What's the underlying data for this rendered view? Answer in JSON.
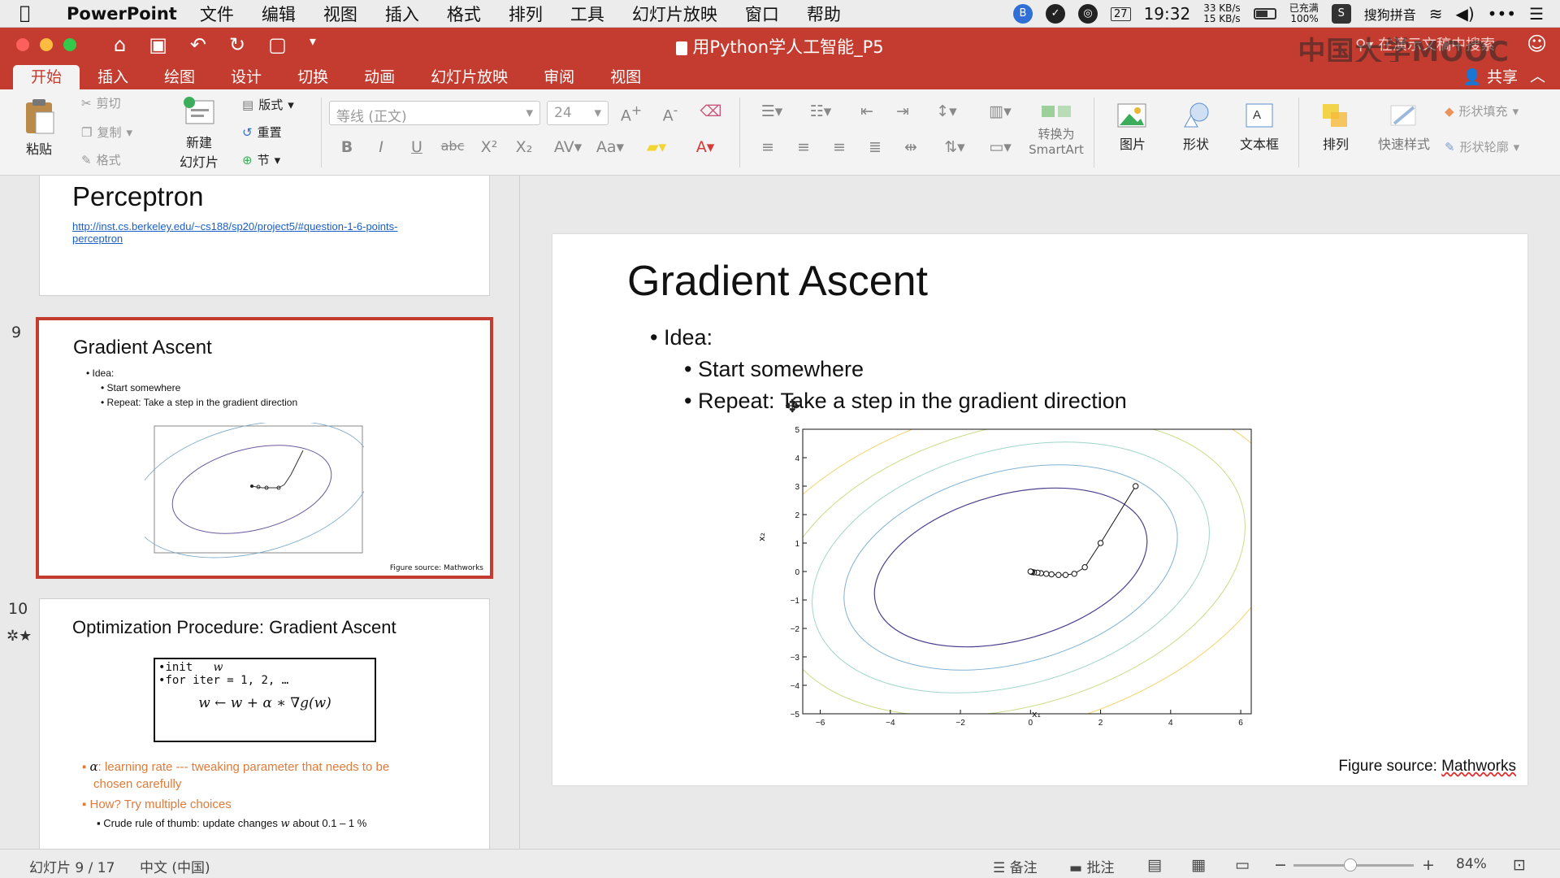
{
  "mac": {
    "app_name": "PowerPoint",
    "menus": [
      "文件",
      "编辑",
      "视图",
      "插入",
      "格式",
      "排列",
      "工具",
      "幻灯片放映",
      "窗口",
      "帮助"
    ],
    "date_badge": "27",
    "time": "19:32",
    "net_up": "33 KB/s",
    "net_down": "15 KB/s",
    "battery_label_1": "已充满",
    "battery_label_2": "100%",
    "ime": "搜狗拼音"
  },
  "window": {
    "title": "用Python学人工智能_P5",
    "search_placeholder": "在演示文稿中搜索",
    "watermark": "中国大学MOOC"
  },
  "tabs": [
    "开始",
    "插入",
    "绘图",
    "设计",
    "切换",
    "动画",
    "幻灯片放映",
    "审阅",
    "视图"
  ],
  "active_tab": "开始",
  "share_label": "共享",
  "ribbon": {
    "paste": "粘贴",
    "cut": "剪切",
    "copy": "复制",
    "format_painter": "格式",
    "new_slide_1": "新建",
    "new_slide_2": "幻灯片",
    "layout": "版式",
    "reset": "重置",
    "section": "节",
    "font_name": "等线 (正文)",
    "font_size": "24",
    "convert_1": "转换为",
    "convert_2": "SmartArt",
    "picture": "图片",
    "shape": "形状",
    "textbox": "文本框",
    "arrange": "排列",
    "quick_styles": "快速样式",
    "shape_fill": "形状填充",
    "shape_outline": "形状轮廓"
  },
  "thumbs": {
    "prev": {
      "title": "Perceptron",
      "link_1": "http://inst.cs.berkeley.edu/~cs188/sp20/project5/#question-1-6-points-",
      "link_2": "perceptron"
    },
    "s9": {
      "number": "9",
      "title": "Gradient Ascent",
      "bullet_1": "Idea:",
      "bullet_2": "Start somewhere",
      "bullet_3": "Repeat:  Take a step in the gradient direction",
      "source": "Figure source: Mathworks"
    },
    "s10": {
      "number": "10",
      "title": "Optimization Procedure: Gradient Ascent",
      "code_1": "init",
      "code_1_var": "w",
      "code_2": "for iter = 1, 2, …",
      "code_3": "w ← w + α ∗ ∇g(w)",
      "note_1": ": learning rate --- tweaking parameter that needs to be",
      "note_1_alpha": "α",
      "note_1b": "chosen carefully",
      "note_2": "How? Try multiple choices",
      "note_3a": "Crude rule of thumb: update changes",
      "note_3_var": "w",
      "note_3b": "about 0.1 – 1 %"
    }
  },
  "slide": {
    "title": "Gradient Ascent",
    "bullet_1": "Idea:",
    "bullet_2": "Start somewhere",
    "bullet_3": "Repeat:  Take a step in the gradient direction",
    "source_prefix": "Figure source: ",
    "source_link": "Mathworks"
  },
  "chart_data": {
    "type": "line",
    "xlabel": "x₁",
    "ylabel": "x₂",
    "xlim": [
      -6.5,
      6.3
    ],
    "ylim": [
      -5,
      5
    ],
    "xticks": [
      -6,
      -4,
      -2,
      0,
      2,
      4,
      6
    ],
    "yticks": [
      5,
      4,
      3,
      2,
      1,
      0,
      -1,
      -2,
      -3,
      -4,
      -5
    ],
    "series": [
      {
        "x": [
          3.0,
          2.0,
          1.55,
          1.25,
          1.0,
          0.8,
          0.6,
          0.45,
          0.3,
          0.2,
          0.1,
          0.05,
          0.02,
          0.0
        ],
        "y": [
          3.0,
          1.0,
          0.15,
          -0.08,
          -0.12,
          -0.12,
          -0.1,
          -0.08,
          -0.06,
          -0.04,
          -0.03,
          -0.02,
          -0.01,
          0.0
        ]
      }
    ],
    "contours": "elliptical level sets centered at origin, tilted",
    "grid": false
  },
  "status": {
    "slide_counter": "幻灯片 9 / 17",
    "language": "中文 (中国)",
    "notes": "备注",
    "comments": "批注",
    "zoom": "84%"
  }
}
